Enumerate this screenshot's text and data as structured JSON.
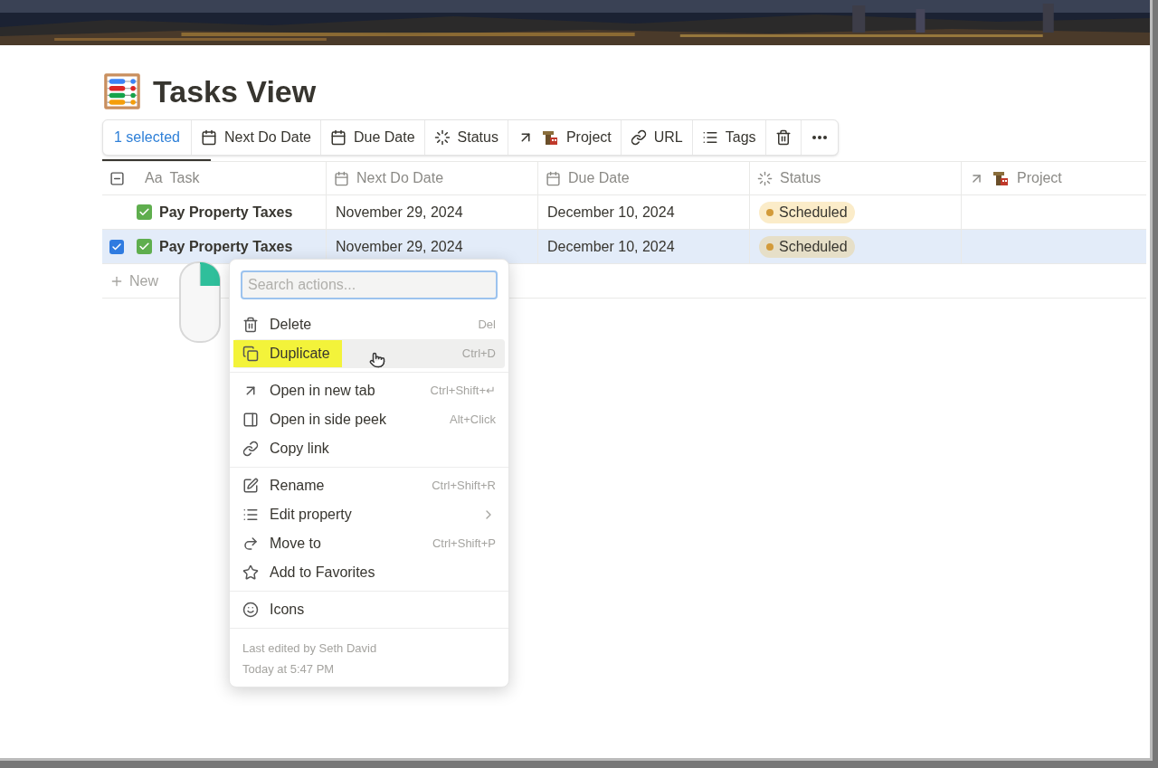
{
  "title": "Tasks View",
  "toolbar": {
    "selection_label": "1 selected",
    "actions": [
      {
        "label": "Next Do Date"
      },
      {
        "label": "Due Date"
      },
      {
        "label": "Status"
      },
      {
        "label": "Project"
      },
      {
        "label": "URL"
      },
      {
        "label": "Tags"
      }
    ]
  },
  "columns": [
    {
      "prefix": "Aa",
      "label": "Task"
    },
    {
      "label": "Next Do Date"
    },
    {
      "label": "Due Date"
    },
    {
      "label": "Status"
    },
    {
      "label": "Project"
    }
  ],
  "rows": [
    {
      "selected": false,
      "done": true,
      "task": "Pay Property Taxes",
      "next_do_date": "November 29, 2024",
      "due_date": "December 10, 2024",
      "status": {
        "label": "Scheduled",
        "color": "#d39b3a"
      }
    },
    {
      "selected": true,
      "done": true,
      "task": "Pay Property Taxes",
      "next_do_date": "November 29, 2024",
      "due_date": "December 10, 2024",
      "status": {
        "label": "Scheduled",
        "color": "#d39b3a"
      }
    }
  ],
  "new_label": "New",
  "context_menu": {
    "search_placeholder": "Search actions...",
    "sections": [
      [
        {
          "label": "Delete",
          "shortcut": "Del",
          "highlighted": false
        },
        {
          "label": "Duplicate",
          "shortcut": "Ctrl+D",
          "highlighted": true
        }
      ],
      [
        {
          "label": "Open in new tab",
          "shortcut": "Ctrl+Shift+↵",
          "highlighted": false
        },
        {
          "label": "Open in side peek",
          "shortcut": "Alt+Click",
          "highlighted": false
        },
        {
          "label": "Copy link",
          "highlighted": false
        }
      ],
      [
        {
          "label": "Rename",
          "shortcut": "Ctrl+Shift+R",
          "highlighted": false
        },
        {
          "label": "Edit property",
          "submenu": true,
          "highlighted": false
        },
        {
          "label": "Move to",
          "shortcut": "Ctrl+Shift+P",
          "highlighted": false
        },
        {
          "label": "Add to Favorites",
          "highlighted": false
        }
      ],
      [
        {
          "label": "Icons",
          "highlighted": false
        }
      ]
    ],
    "footer": [
      "Last edited by Seth David",
      "Today at 5:47 PM"
    ]
  }
}
